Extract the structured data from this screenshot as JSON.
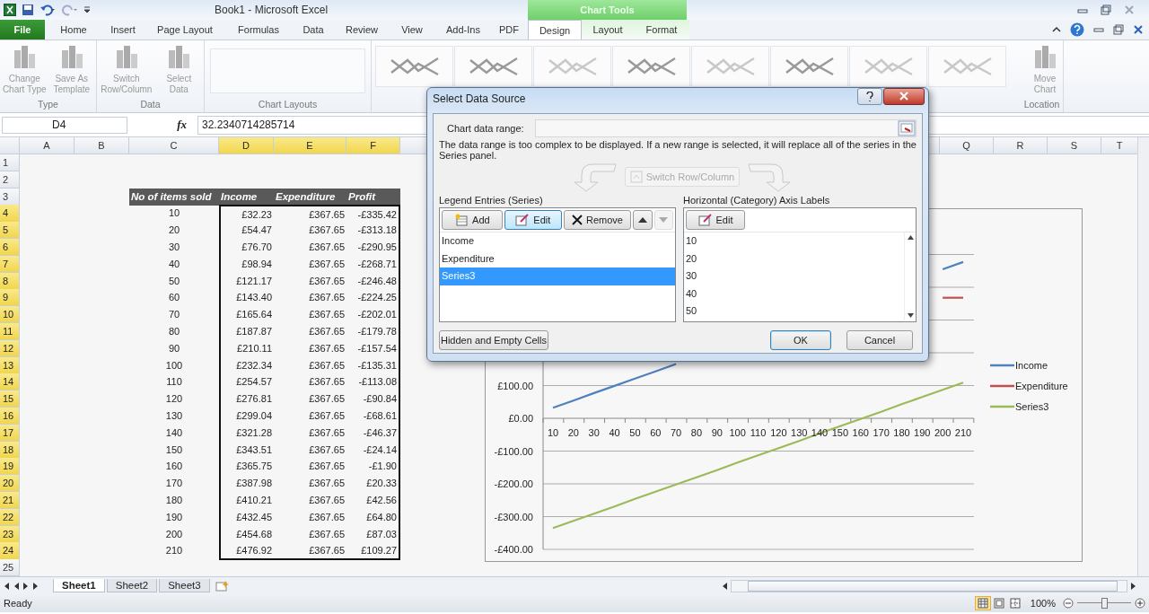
{
  "title_bar": {
    "title": "Book1  -  Microsoft Excel",
    "context_group": "Chart Tools"
  },
  "ribbon_tabs": [
    {
      "label": "File",
      "kind": "file",
      "selected": false
    },
    {
      "label": "Home",
      "kind": "normal",
      "selected": false
    },
    {
      "label": "Insert",
      "kind": "normal",
      "selected": false
    },
    {
      "label": "Page Layout",
      "kind": "normal",
      "selected": false
    },
    {
      "label": "Formulas",
      "kind": "normal",
      "selected": false
    },
    {
      "label": "Data",
      "kind": "normal",
      "selected": false
    },
    {
      "label": "Review",
      "kind": "normal",
      "selected": false
    },
    {
      "label": "View",
      "kind": "normal",
      "selected": false
    },
    {
      "label": "Add-Ins",
      "kind": "normal",
      "selected": false
    },
    {
      "label": "PDF",
      "kind": "normal",
      "selected": false
    },
    {
      "label": "Design",
      "kind": "context",
      "selected": true
    },
    {
      "label": "Layout",
      "kind": "context",
      "selected": false
    },
    {
      "label": "Format",
      "kind": "context",
      "selected": false
    }
  ],
  "ribbon_groups": [
    {
      "label": "Type",
      "kind": "buttons",
      "buttons": [
        "Change Chart Type",
        "Save As Template"
      ]
    },
    {
      "label": "Data",
      "kind": "buttons",
      "buttons": [
        "Switch Row/Column",
        "Select Data"
      ]
    },
    {
      "label": "Chart Layouts",
      "kind": "gallery"
    },
    {
      "kind": "styles"
    },
    {
      "label": "Location",
      "kind": "buttons",
      "buttons": [
        "Move Chart"
      ]
    }
  ],
  "formula_bar": {
    "name_box": "D4",
    "fx": "fx",
    "value": "32.2340714285714"
  },
  "sheet": {
    "columns": [
      {
        "label": "A",
        "selected": false
      },
      {
        "label": "B",
        "selected": false
      },
      {
        "label": "C",
        "selected": false
      },
      {
        "label": "D",
        "selected": true
      },
      {
        "label": "E",
        "selected": true
      },
      {
        "label": "F",
        "selected": true
      },
      {
        "label": "Q",
        "selected": false
      },
      {
        "label": "R",
        "selected": false
      },
      {
        "label": "S",
        "selected": false
      },
      {
        "label": "T",
        "selected": false
      }
    ],
    "rows": [
      {
        "label": "1",
        "selected": false
      },
      {
        "label": "2",
        "selected": false
      },
      {
        "label": "3",
        "selected": false,
        "kind": "heading",
        "cells": [
          "No of items sold",
          "Income",
          "Expenditure",
          "Profit"
        ]
      },
      {
        "label": "4",
        "selected": true,
        "kind": "data",
        "cells": [
          "10",
          "£32.23",
          "£367.65",
          "-£335.42"
        ]
      },
      {
        "label": "5",
        "selected": true,
        "kind": "data",
        "cells": [
          "20",
          "£54.47",
          "£367.65",
          "-£313.18"
        ]
      },
      {
        "label": "6",
        "selected": true,
        "kind": "data",
        "cells": [
          "30",
          "£76.70",
          "£367.65",
          "-£290.95"
        ]
      },
      {
        "label": "7",
        "selected": true,
        "kind": "data",
        "cells": [
          "40",
          "£98.94",
          "£367.65",
          "-£268.71"
        ]
      },
      {
        "label": "8",
        "selected": true,
        "kind": "data",
        "cells": [
          "50",
          "£121.17",
          "£367.65",
          "-£246.48"
        ]
      },
      {
        "label": "9",
        "selected": true,
        "kind": "data",
        "cells": [
          "60",
          "£143.40",
          "£367.65",
          "-£224.25"
        ]
      },
      {
        "label": "10",
        "selected": true,
        "kind": "data",
        "cells": [
          "70",
          "£165.64",
          "£367.65",
          "-£202.01"
        ]
      },
      {
        "label": "11",
        "selected": true,
        "kind": "data",
        "cells": [
          "80",
          "£187.87",
          "£367.65",
          "-£179.78"
        ]
      },
      {
        "label": "12",
        "selected": true,
        "kind": "data",
        "cells": [
          "90",
          "£210.11",
          "£367.65",
          "-£157.54"
        ]
      },
      {
        "label": "13",
        "selected": true,
        "kind": "data",
        "cells": [
          "100",
          "£232.34",
          "£367.65",
          "-£135.31"
        ]
      },
      {
        "label": "14",
        "selected": true,
        "kind": "data",
        "cells": [
          "110",
          "£254.57",
          "£367.65",
          "-£113.08"
        ]
      },
      {
        "label": "15",
        "selected": true,
        "kind": "data",
        "cells": [
          "120",
          "£276.81",
          "£367.65",
          "-£90.84"
        ]
      },
      {
        "label": "16",
        "selected": true,
        "kind": "data",
        "cells": [
          "130",
          "£299.04",
          "£367.65",
          "-£68.61"
        ]
      },
      {
        "label": "17",
        "selected": true,
        "kind": "data",
        "cells": [
          "140",
          "£321.28",
          "£367.65",
          "-£46.37"
        ]
      },
      {
        "label": "18",
        "selected": true,
        "kind": "data",
        "cells": [
          "150",
          "£343.51",
          "£367.65",
          "-£24.14"
        ]
      },
      {
        "label": "19",
        "selected": true,
        "kind": "data",
        "cells": [
          "160",
          "£365.75",
          "£367.65",
          "-£1.90"
        ]
      },
      {
        "label": "20",
        "selected": true,
        "kind": "data",
        "cells": [
          "170",
          "£387.98",
          "£367.65",
          "£20.33"
        ]
      },
      {
        "label": "21",
        "selected": true,
        "kind": "data",
        "cells": [
          "180",
          "£410.21",
          "£367.65",
          "£42.56"
        ]
      },
      {
        "label": "22",
        "selected": true,
        "kind": "data",
        "cells": [
          "190",
          "£432.45",
          "£367.65",
          "£64.80"
        ]
      },
      {
        "label": "23",
        "selected": true,
        "kind": "data",
        "cells": [
          "200",
          "£454.68",
          "£367.65",
          "£87.03"
        ]
      },
      {
        "label": "24",
        "selected": true,
        "kind": "data",
        "cells": [
          "210",
          "£476.92",
          "£367.65",
          "£109.27"
        ]
      },
      {
        "label": "25",
        "selected": false
      }
    ]
  },
  "chart": {
    "chart_data": {
      "type": "line",
      "categories": [
        "10",
        "20",
        "30",
        "40",
        "50",
        "60",
        "70",
        "80",
        "90",
        "100",
        "110",
        "120",
        "130",
        "140",
        "150",
        "160",
        "170",
        "180",
        "190",
        "200",
        "210"
      ],
      "series": [
        {
          "name": "Income",
          "color": "#4f81bd",
          "values": [
            32,
            54,
            77,
            99,
            121,
            143,
            166,
            null,
            null,
            null,
            null,
            null,
            null,
            null,
            null,
            null,
            null,
            null,
            null,
            455,
            477
          ]
        },
        {
          "name": "Expenditure",
          "color": "#c0504d",
          "values": [
            null,
            null,
            null,
            null,
            null,
            null,
            null,
            null,
            null,
            null,
            null,
            null,
            null,
            null,
            null,
            null,
            null,
            null,
            null,
            368,
            368
          ]
        },
        {
          "name": "Series3",
          "color": "#9bbb59",
          "values": [
            -335,
            -313,
            -291,
            -269,
            -246,
            -224,
            -202,
            -180,
            -158,
            -135,
            -113,
            -91,
            -69,
            -46,
            -24,
            -2,
            20,
            43,
            65,
            87,
            109
          ]
        }
      ],
      "grid": true,
      "legend": true,
      "ylim": [
        -400,
        500
      ],
      "yticks": [
        {
          "value": -400,
          "label": "-£400.00"
        },
        {
          "value": -300,
          "label": "-£300.00"
        },
        {
          "value": -200,
          "label": "-£200.00"
        },
        {
          "value": -100,
          "label": "-£100.00"
        },
        {
          "value": 0,
          "label": "£0.00"
        },
        {
          "value": 100,
          "label": "£100.00"
        }
      ]
    }
  },
  "dialog": {
    "title": "Select Data Source",
    "range_label": "Chart data range:",
    "message": "The data range is too complex to be displayed. If a new range is selected, it will replace all of the series in the Series panel.",
    "switch_button": {
      "label": "Switch Row/Column",
      "disabled": true
    },
    "legend": {
      "heading": "Legend Entries (Series)",
      "buttons": [
        {
          "kind": "add",
          "label": "Add",
          "hovered": false,
          "disabled": false
        },
        {
          "kind": "edit",
          "label": "Edit",
          "hovered": true,
          "disabled": false
        },
        {
          "kind": "remove",
          "label": "Remove",
          "hovered": false,
          "disabled": false
        },
        {
          "kind": "up",
          "hovered": false,
          "disabled": false
        },
        {
          "kind": "down",
          "hovered": false,
          "disabled": true
        }
      ],
      "items": [
        {
          "label": "Income",
          "selected": false
        },
        {
          "label": "Expenditure",
          "selected": false
        },
        {
          "label": "Series3",
          "selected": true
        }
      ]
    },
    "axis": {
      "heading": "Horizontal (Category) Axis Labels",
      "edit_button": "Edit",
      "items": [
        "10",
        "20",
        "30",
        "40",
        "50"
      ]
    },
    "hidden_cells_button": "Hidden and Empty Cells",
    "ok_button": "OK",
    "cancel_button": "Cancel"
  },
  "sheet_tabs": [
    {
      "label": "Sheet1",
      "selected": true
    },
    {
      "label": "Sheet2",
      "selected": false
    },
    {
      "label": "Sheet3",
      "selected": false
    }
  ],
  "status_bar": {
    "status": "Ready",
    "views": [
      {
        "kind": "normal",
        "selected": true
      },
      {
        "kind": "page_layout",
        "selected": false
      },
      {
        "kind": "page_break",
        "selected": false
      }
    ],
    "zoom": "100%",
    "zoom_slider": {
      "level": 0.5
    }
  }
}
